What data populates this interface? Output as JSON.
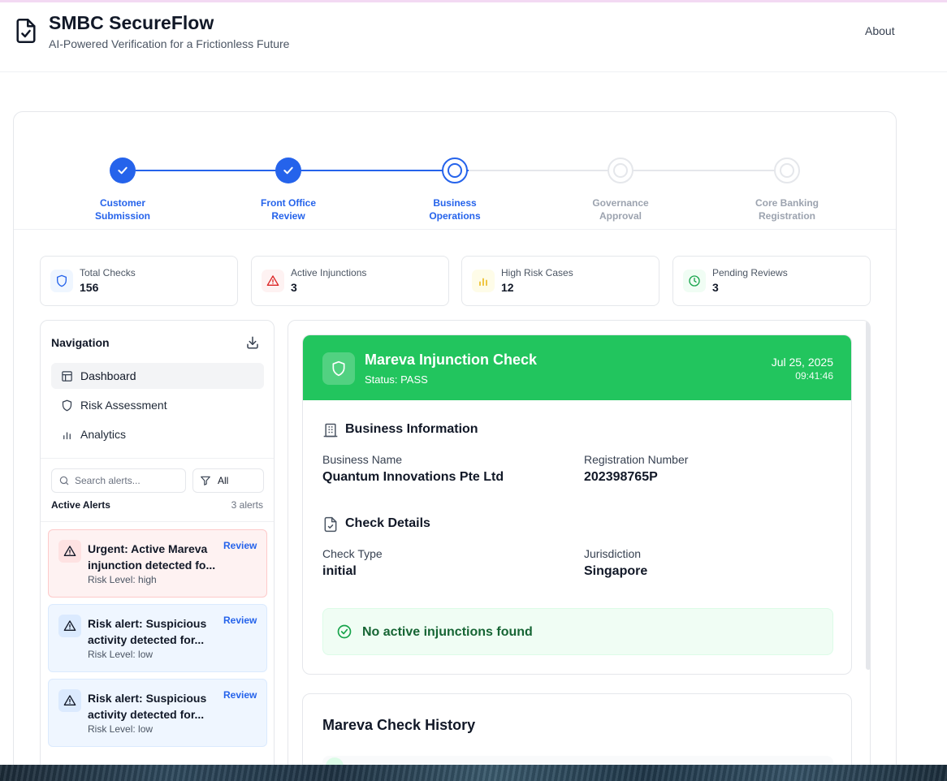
{
  "app": {
    "title": "SMBC SecureFlow",
    "subtitle": "AI-Powered Verification for a Frictionless Future",
    "about_label": "About",
    "logo_icon": "file-check-icon"
  },
  "stepper": {
    "steps": [
      {
        "label_line1": "Customer",
        "label_line2": "Submission",
        "state": "completed"
      },
      {
        "label_line1": "Front Office",
        "label_line2": "Review",
        "state": "completed"
      },
      {
        "label_line1": "Business",
        "label_line2": "Operations",
        "state": "current"
      },
      {
        "label_line1": "Governance",
        "label_line2": "Approval",
        "state": "pending"
      },
      {
        "label_line1": "Core Banking",
        "label_line2": "Registration",
        "state": "pending"
      }
    ],
    "active_color": "#2563eb",
    "inactive_color": "#e5e7eb"
  },
  "stats": [
    {
      "label": "Total Checks",
      "value": "156",
      "icon": "shield-icon",
      "color": "#2563eb"
    },
    {
      "label": "Active Injunctions",
      "value": "3",
      "icon": "alert-triangle-icon",
      "color": "#dc2626"
    },
    {
      "label": "High Risk Cases",
      "value": "12",
      "icon": "bar-chart-icon",
      "color": "#eab308"
    },
    {
      "label": "Pending Reviews",
      "value": "3",
      "icon": "clock-icon",
      "color": "#16a34a"
    }
  ],
  "navigation": {
    "title": "Navigation",
    "items": [
      {
        "label": "Dashboard",
        "icon": "layout-icon",
        "active": true
      },
      {
        "label": "Risk Assessment",
        "icon": "shield-icon",
        "active": false
      },
      {
        "label": "Analytics",
        "icon": "bar-chart-icon",
        "active": false
      }
    ],
    "search_placeholder": "Search alerts...",
    "filter_value": "All",
    "alerts_heading": "Active Alerts",
    "alerts_count": "3 alerts",
    "alerts": [
      {
        "line1": "Urgent: Active Mareva",
        "line2": "injunction detected fo...",
        "risk": "Risk Level: high",
        "level": "high",
        "action": "Review"
      },
      {
        "line1": "Risk alert: Suspicious",
        "line2": "activity detected for...",
        "risk": "Risk Level: low",
        "level": "low",
        "action": "Review"
      },
      {
        "line1": "Risk alert: Suspicious",
        "line2": "activity detected for...",
        "risk": "Risk Level: low",
        "level": "low",
        "action": "Review"
      }
    ]
  },
  "check": {
    "title": "Mareva Injunction Check",
    "status": "Status: PASS",
    "date": "Jul 25, 2025",
    "time": "09:41:46",
    "status_color": "#22c55e",
    "business_section": "Business Information",
    "business_name_label": "Business Name",
    "business_name": "Quantum Innovations Pte Ltd",
    "reg_label": "Registration Number",
    "reg_number": "202398765P",
    "details_section": "Check Details",
    "check_type_label": "Check Type",
    "check_type": "initial",
    "jurisdiction_label": "Jurisdiction",
    "jurisdiction": "Singapore",
    "result_message": "No active injunctions found"
  },
  "history": {
    "title": "Mareva Check History"
  }
}
